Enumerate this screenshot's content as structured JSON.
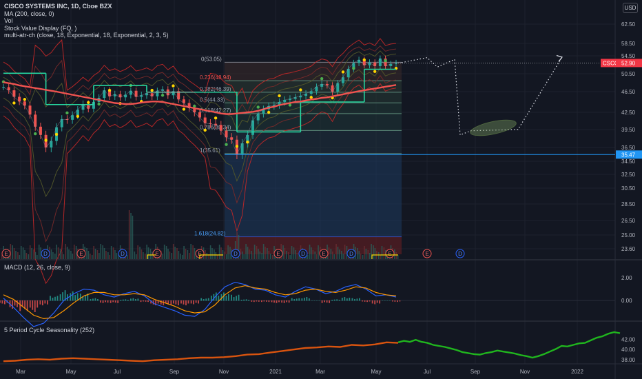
{
  "legend": {
    "title": "CISCO SYSTEMS INC, 1D, Cboe BZX",
    "lines": [
      "MA (200, close, 0)",
      "Vol",
      "Stock Value Display (FQ, )",
      "multi-atr-ch (close, 18, Exponential, 18, Exponential, 2, 3, 5)"
    ]
  },
  "currency_button": "USD",
  "macd_legend": "MACD (12, 26, close, 9)",
  "season_legend": "5 Period Cycle Seasonality (252)",
  "colors": {
    "background": "#131722",
    "grid": "#1e222d",
    "up": "#26a69a",
    "down": "#ef5350",
    "ma": "#f05350",
    "step": "#26d7a0",
    "fib_top": "#5a1e22",
    "fib_bottom": "#1e3a5f",
    "macd": "#2962ff",
    "signal": "#ff9800",
    "season_hist": "#d9540f",
    "season_proj": "#20b51e",
    "price_tag": "#f23645",
    "level_tag": "#2196f3"
  },
  "chart_data": [
    {
      "type": "line",
      "title": "CISCO SYSTEMS INC, 1D, Cboe BZX",
      "x_ticks": [
        "Mar",
        "May",
        "Jul",
        "Sep",
        "Nov",
        "2021",
        "Mar",
        "May",
        "Jul",
        "Sep",
        "Nov",
        "2022"
      ],
      "y_ticks": [
        "62.50",
        "58.50",
        "54.50",
        "50.50",
        "46.50",
        "42.50",
        "39.50",
        "36.50",
        "34.50",
        "32.50",
        "30.50",
        "28.50",
        "26.50",
        "25.00",
        "23.60"
      ],
      "ylim": [
        23.6,
        62.5
      ],
      "series": [
        {
          "name": "CSCO",
          "values": [
            47.5,
            46.8,
            45.5,
            44.6,
            43.8,
            42.1,
            40.0,
            38.6,
            36.5,
            37.6,
            39.9,
            41.3,
            41.2,
            42.0,
            43.0,
            44.1,
            43.2,
            44.5,
            45.3,
            46.8,
            45.6,
            46.0,
            45.4,
            45.9,
            46.7,
            45.5,
            45.8,
            46.2,
            45.6,
            46.7,
            47.0,
            45.8,
            46.6,
            45.0,
            44.3,
            43.3,
            42.5,
            41.6,
            40.6,
            40.5,
            40.3,
            39.3,
            38.2,
            37.8,
            35.5,
            37.2,
            38.6,
            41.1,
            42.3,
            43.1,
            43.7,
            43.9,
            44.5,
            44.9,
            45.1,
            45.4,
            45.7,
            46.1,
            46.6,
            47.6,
            48.2,
            47.9,
            46.5,
            48.4,
            49.7,
            51.6,
            52.9,
            53.6,
            52.4,
            53.0,
            52.2,
            53.9,
            52.2,
            52.7,
            52.9
          ]
        },
        {
          "name": "MA (200, close, 0)",
          "values": [
            48.6,
            48.4,
            48.2,
            47.9,
            47.7,
            47.5,
            47.3,
            47.1,
            46.9,
            46.7,
            46.5,
            46.3,
            46.1,
            45.9,
            45.7,
            45.5,
            45.3,
            45.1,
            44.9,
            44.7,
            44.5,
            44.3,
            44.2,
            44.1,
            44.1,
            44.2,
            44.4,
            44.5,
            44.6,
            44.6,
            44.5,
            44.3,
            44.1,
            43.9,
            43.7,
            43.5,
            43.3,
            43.1,
            42.9,
            42.7,
            42.5,
            42.3,
            42.2,
            42.2,
            42.3,
            42.4,
            42.5,
            42.6,
            42.8,
            43.1,
            43.4,
            43.6,
            43.9,
            44.1,
            44.3,
            44.5,
            44.6,
            44.8,
            45.0,
            45.1,
            45.3,
            45.4,
            45.6,
            45.8,
            46.0,
            46.2,
            46.4,
            46.6,
            46.8,
            47.0,
            47.2,
            47.4,
            47.6,
            47.8,
            48.0
          ]
        }
      ],
      "step_levels": [
        {
          "from": 0,
          "to": 8,
          "value": 50.6
        },
        {
          "from": 8,
          "to": 17,
          "value": 44.0
        },
        {
          "from": 17,
          "to": 27,
          "value": 47.9
        },
        {
          "from": 27,
          "to": 44,
          "value": 46.4
        },
        {
          "from": 44,
          "to": 56,
          "value": 39.1
        },
        {
          "from": 56,
          "to": 68,
          "value": 44.5
        },
        {
          "from": 68,
          "to": 74,
          "value": 51.5
        }
      ],
      "fibonacci": [
        {
          "label": "0(53.05)",
          "value": 53.05
        },
        {
          "label": "0.236(48.94)",
          "value": 48.94
        },
        {
          "label": "0.382(46.39)",
          "value": 46.39
        },
        {
          "label": "0.5(44.33)",
          "value": 44.33
        },
        {
          "label": "0.618(42.27)",
          "value": 42.27
        },
        {
          "label": "0.786(39.34)",
          "value": 39.34
        },
        {
          "label": "1(35.61)",
          "value": 35.61
        },
        {
          "label": "1.618(24.82)",
          "value": 24.82
        }
      ],
      "projection": [
        53.0,
        54.1,
        52.0,
        53.7,
        38.6,
        39.3,
        39.5,
        54.2
      ],
      "price_label": {
        "text": "CSCO",
        "value": "52.90"
      },
      "level_label": "35.47",
      "events": [
        "E",
        "D",
        "E",
        "D",
        "E",
        "E",
        "D",
        "E",
        "D",
        "E",
        "D",
        "E",
        "E",
        "D",
        "E"
      ]
    },
    {
      "type": "line",
      "title": "MACD (12, 26, close, 9)",
      "y_ticks": [
        "2.00",
        "0.00"
      ],
      "ylim": [
        -2.5,
        3.2
      ],
      "series": [
        {
          "name": "MACD",
          "values": [
            0.2,
            -0.6,
            -1.5,
            -2.3,
            -2.0,
            -1.1,
            0.0,
            0.6,
            1.0,
            0.9,
            0.5,
            0.3,
            0.6,
            0.8,
            0.4,
            -0.3,
            -0.6,
            -0.9,
            -1.3,
            -1.4,
            -0.8,
            0.3,
            1.2,
            1.6,
            1.4,
            1.0,
            0.9,
            0.5,
            0.3,
            0.8,
            1.2,
            1.0,
            0.6,
            0.8,
            1.2,
            1.4,
            1.0,
            0.4,
            0.5,
            0.3
          ]
        },
        {
          "name": "Signal",
          "values": [
            0.5,
            0.1,
            -0.6,
            -1.3,
            -1.6,
            -1.5,
            -0.9,
            -0.2,
            0.4,
            0.7,
            0.7,
            0.5,
            0.5,
            0.6,
            0.5,
            0.1,
            -0.2,
            -0.5,
            -0.9,
            -1.1,
            -1.0,
            -0.4,
            0.5,
            1.1,
            1.3,
            1.1,
            1.0,
            0.7,
            0.5,
            0.6,
            0.9,
            1.0,
            0.8,
            0.7,
            0.9,
            1.2,
            1.1,
            0.7,
            0.5,
            0.4
          ]
        }
      ]
    },
    {
      "type": "area",
      "title": "5 Period Cycle Seasonality (252)",
      "y_ticks": [
        "42.00",
        "40.00",
        "38.00"
      ],
      "ylim": [
        37.2,
        43.6
      ],
      "series": [
        {
          "name": "Seasonality",
          "values": [
            37.7,
            37.8,
            38.0,
            38.1,
            38.0,
            38.2,
            38.3,
            38.2,
            38.1,
            38.0,
            37.9,
            37.8,
            37.7,
            37.9,
            38.0,
            38.1,
            38.3,
            38.4,
            38.4,
            38.5,
            38.7,
            39.0,
            39.1,
            39.4,
            39.7,
            40.0,
            40.3,
            40.4,
            40.6,
            40.5,
            40.9,
            40.8,
            41.0,
            41.4,
            41.3
          ]
        },
        {
          "name": "Projection",
          "values": [
            41.4,
            41.7,
            41.5,
            41.9,
            41.5,
            41.3,
            40.9,
            40.7,
            40.5,
            40.2,
            39.9,
            39.5,
            39.3,
            39.1,
            39.0,
            39.3,
            39.5,
            39.8,
            39.6,
            39.4,
            39.2,
            38.9,
            38.7,
            38.4,
            38.7,
            39.1,
            39.6,
            40.1,
            40.7,
            40.6,
            40.9,
            41.2,
            41.3,
            41.8,
            42.3,
            42.6,
            43.1,
            43.4,
            43.2
          ]
        }
      ]
    }
  ]
}
